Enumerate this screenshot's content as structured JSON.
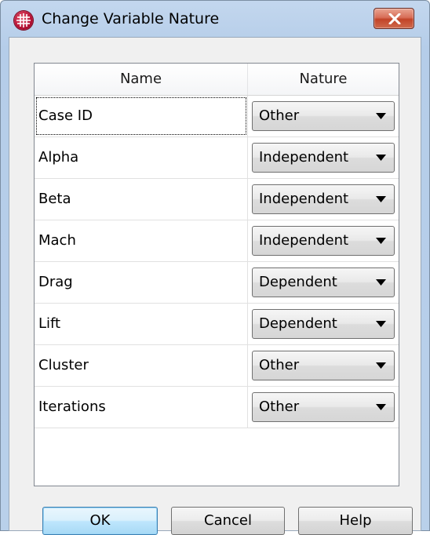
{
  "window": {
    "title": "Change Variable Nature",
    "app_icon": "grid-globe-icon",
    "close_icon": "close-x-icon"
  },
  "table": {
    "columns": {
      "name": "Name",
      "nature": "Nature"
    },
    "rows": [
      {
        "name": "Case ID",
        "nature": "Other"
      },
      {
        "name": "Alpha",
        "nature": "Independent"
      },
      {
        "name": "Beta",
        "nature": "Independent"
      },
      {
        "name": "Mach",
        "nature": "Independent"
      },
      {
        "name": "Drag",
        "nature": "Dependent"
      },
      {
        "name": "Lift",
        "nature": "Dependent"
      },
      {
        "name": "Cluster",
        "nature": "Other"
      },
      {
        "name": "Iterations",
        "nature": "Other"
      }
    ]
  },
  "buttons": {
    "ok": "OK",
    "cancel": "Cancel",
    "help": "Help"
  },
  "colors": {
    "title_bar": "#b9d0ea",
    "close_button": "#c24428",
    "default_button_border": "#3c7fb1",
    "dialog_background": "#f0f0f0"
  }
}
